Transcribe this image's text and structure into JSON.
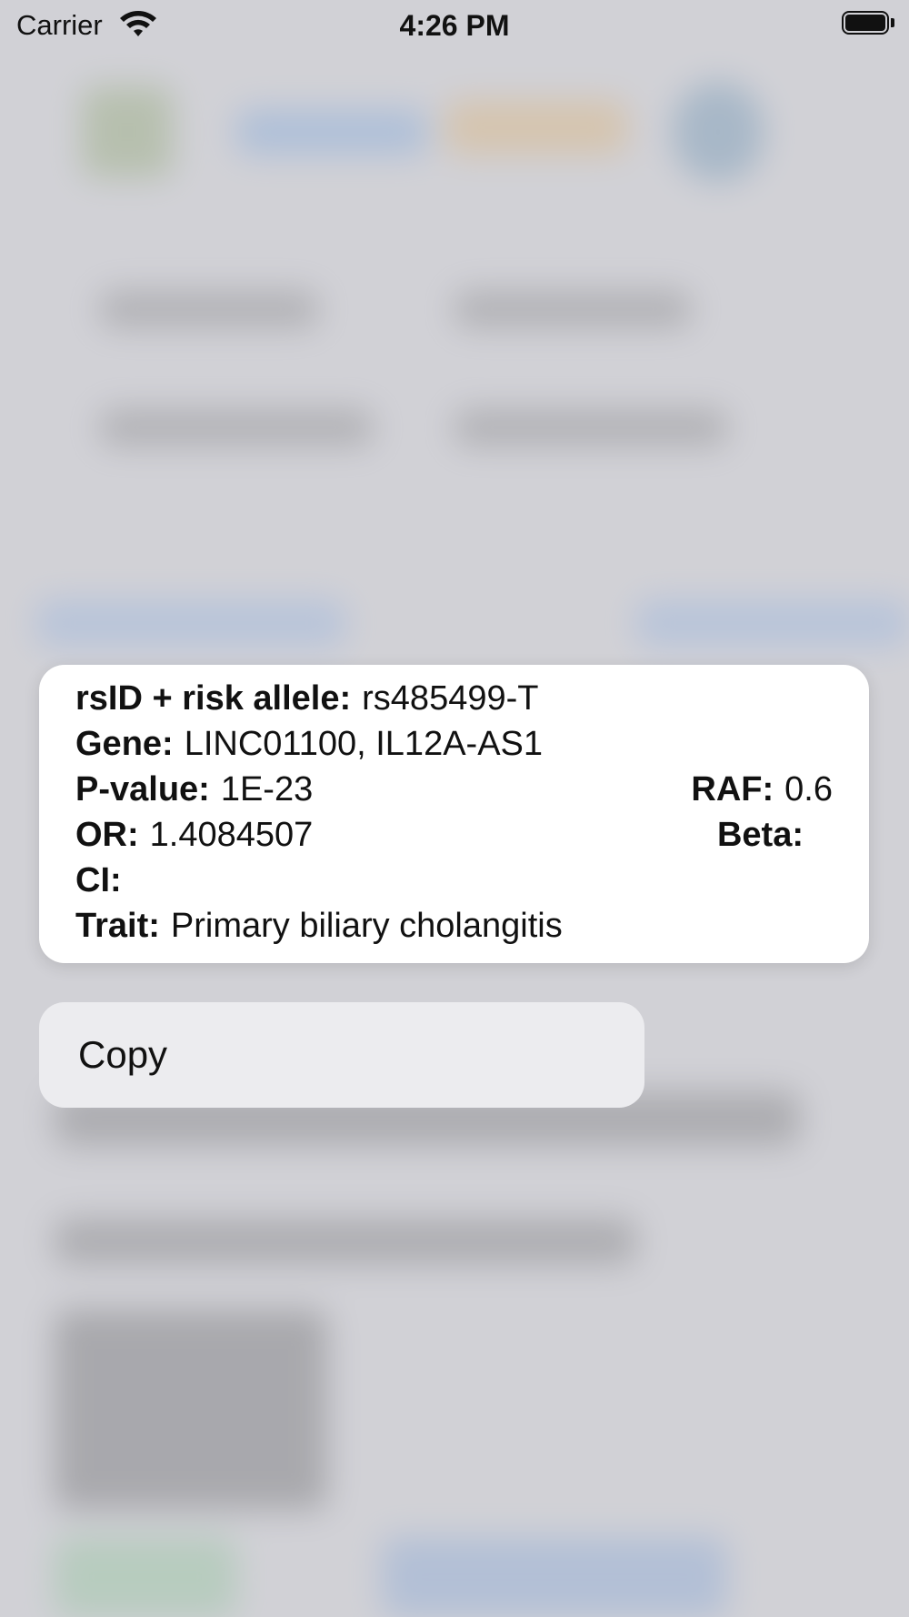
{
  "status_bar": {
    "carrier": "Carrier",
    "time": "4:26 PM",
    "icons": [
      "wifi-icon",
      "battery-icon"
    ]
  },
  "preview": {
    "rsid_label": "rsID + risk allele:",
    "rsid_value": "rs485499-T",
    "gene_label": "Gene:",
    "gene_value": "LINC01100, IL12A-AS1",
    "pvalue_label": "P-value:",
    "pvalue_value": "1E-23",
    "raf_label": "RAF:",
    "raf_value": "0.6",
    "or_label": "OR:",
    "or_value": "1.4084507",
    "beta_label": "Beta:",
    "beta_value": "",
    "ci_label": "CI:",
    "ci_value": "",
    "trait_label": "Trait:",
    "trait_value": "Primary biliary cholangitis"
  },
  "context_menu": {
    "items": [
      {
        "label": "Copy"
      }
    ]
  },
  "colors": {
    "background": "#d5d5da",
    "card": "#ffffff",
    "menu": "#ececef",
    "text": "#111111"
  }
}
